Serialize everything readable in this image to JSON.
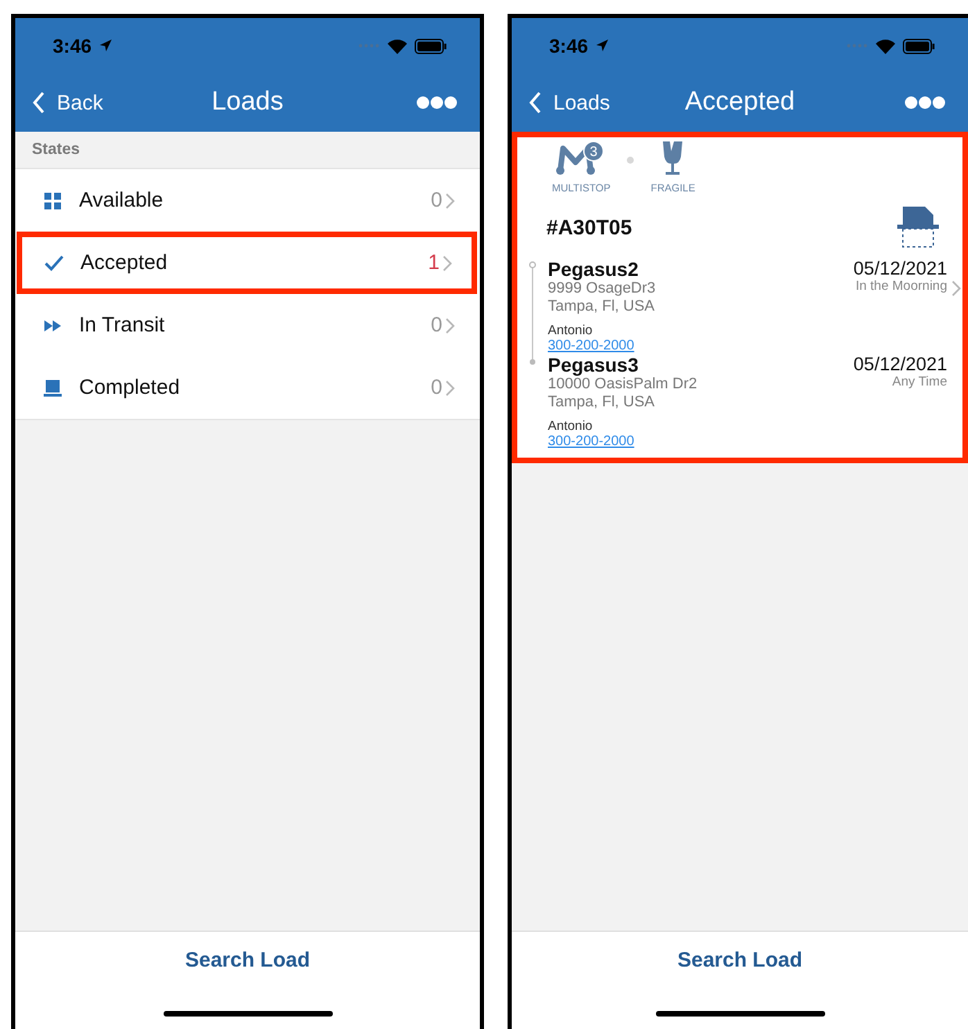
{
  "left_screen": {
    "status_bar": {
      "time": "3:46"
    },
    "nav": {
      "back": "Back",
      "title": "Loads"
    },
    "section_header": "States",
    "states": [
      {
        "label": "Available",
        "count": "0",
        "kind": "grid",
        "alert": false,
        "highlighted": false
      },
      {
        "label": "Accepted",
        "count": "1",
        "kind": "check",
        "alert": true,
        "highlighted": true
      },
      {
        "label": "In Transit",
        "count": "0",
        "kind": "forward",
        "alert": false,
        "highlighted": false
      },
      {
        "label": "Completed",
        "count": "0",
        "kind": "laptop",
        "alert": false,
        "highlighted": false
      }
    ],
    "bottom_button": "Search Load"
  },
  "right_screen": {
    "status_bar": {
      "time": "3:46"
    },
    "nav": {
      "back": "Loads",
      "title": "Accepted"
    },
    "card": {
      "highlighted": true,
      "tags": [
        {
          "label": "MULTISTOP",
          "kind": "multistop",
          "badge": "3"
        },
        {
          "label": "FRAGILE",
          "kind": "fragile"
        }
      ],
      "load_id": "#A30T05",
      "stops": [
        {
          "name": "Pegasus2",
          "address_line_1": "9999 OsageDr3",
          "address_line_2": "Tampa, Fl, USA",
          "contact": "Antonio",
          "phone": "300-200-2000",
          "date": "05/12/2021",
          "time": "In the Moorning",
          "chevron": true
        },
        {
          "name": "Pegasus3",
          "address_line_1": "10000 OasisPalm Dr2",
          "address_line_2": "Tampa, Fl, USA",
          "contact": "Antonio",
          "phone": "300-200-2000",
          "date": "05/12/2021",
          "time": "Any Time",
          "chevron": false
        }
      ]
    },
    "bottom_button": "Search Load"
  }
}
